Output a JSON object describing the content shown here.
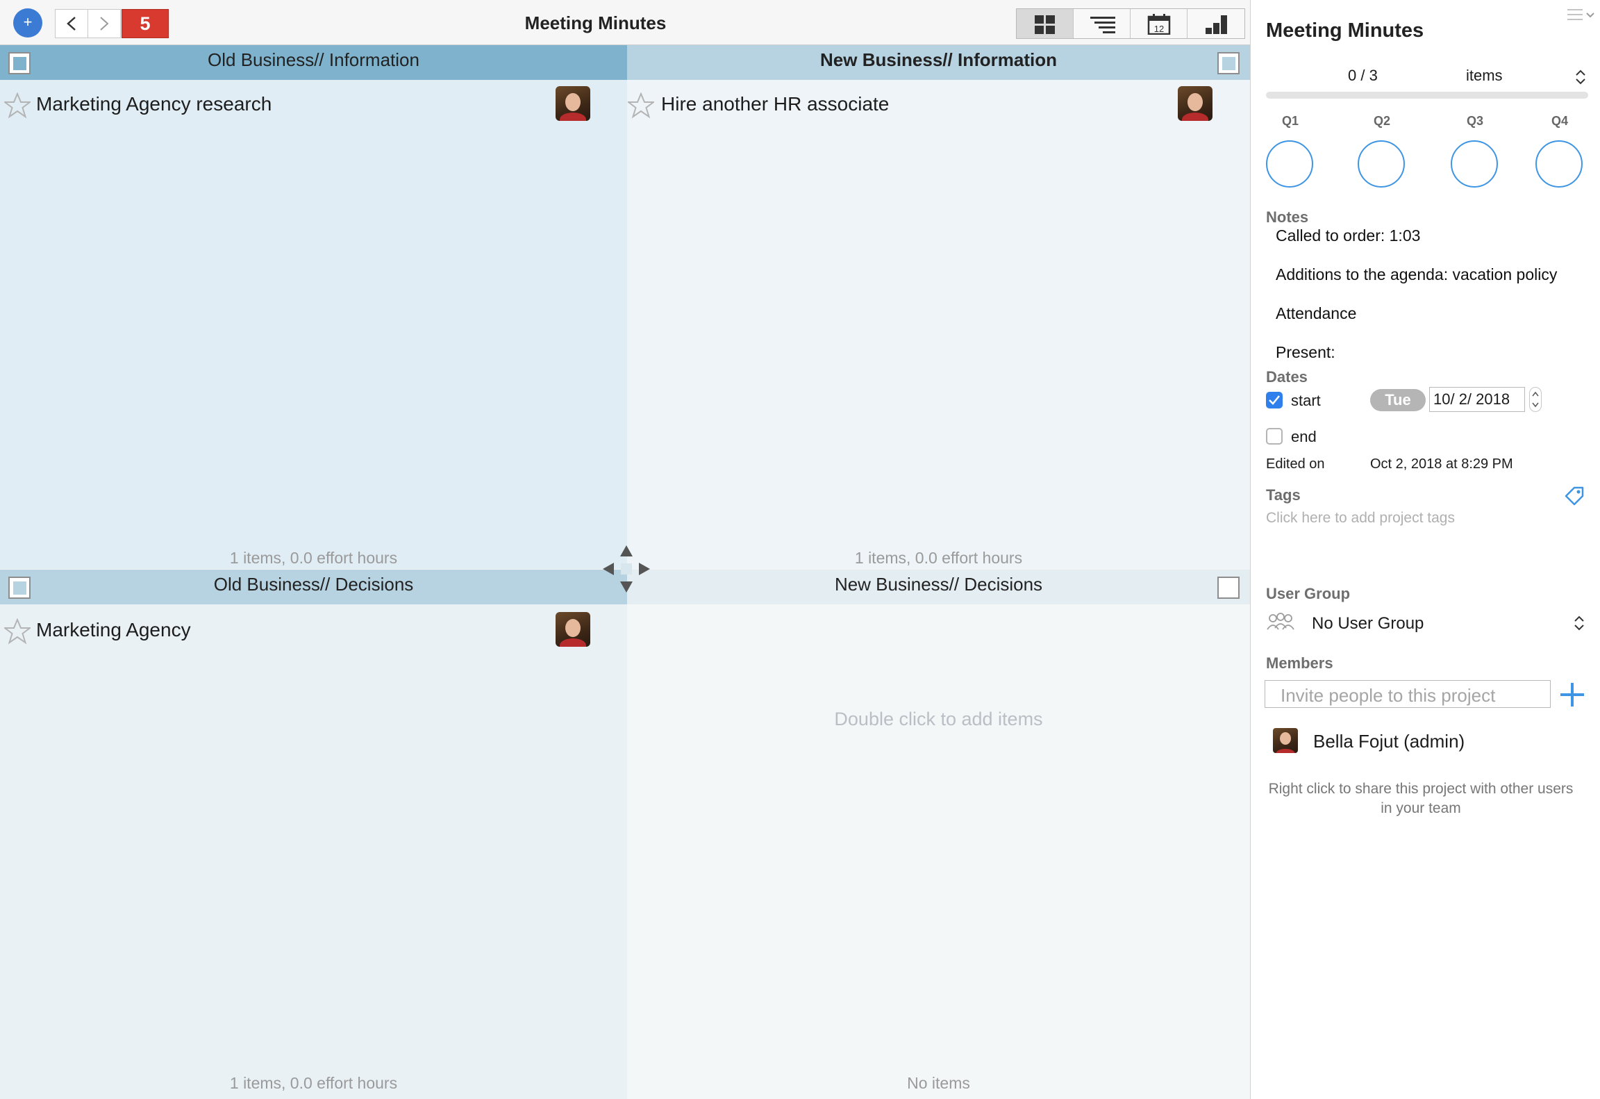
{
  "toolbar": {
    "add_label": "+",
    "count_badge": "5",
    "window_title": "Meeting Minutes",
    "views": [
      "matrix-view",
      "outline-view",
      "calendar-view",
      "chart-view"
    ],
    "calendar_day": "12"
  },
  "quadrants": {
    "q1": {
      "title": "Old Business// Information",
      "tasks": [
        {
          "label": "Marketing Agency research"
        }
      ],
      "footer": "1 items, 0.0 effort hours"
    },
    "q2": {
      "title": "New Business// Information",
      "tasks": [
        {
          "label": "Hire another HR associate"
        }
      ],
      "footer": "1 items, 0.0 effort hours"
    },
    "q3": {
      "title": "Old Business// Decisions",
      "tasks": [
        {
          "label": "Marketing Agency"
        }
      ],
      "footer": "1 items, 0.0 effort hours"
    },
    "q4": {
      "title": "New Business// Decisions",
      "empty_hint": "Double click to add items",
      "footer": "No items"
    }
  },
  "panel": {
    "title": "Meeting Minutes",
    "progress": {
      "text": "0 / 3",
      "unit": "items",
      "fraction": 0
    },
    "quarters": [
      "Q1",
      "Q2",
      "Q3",
      "Q4"
    ],
    "notes_label": "Notes",
    "notes": [
      "Called to order: 1:03",
      "Additions to the agenda: vacation policy",
      "Attendance",
      "Present:"
    ],
    "dates_label": "Dates",
    "start_label": "start",
    "start_checked": true,
    "start_day": "Tue",
    "start_date": "10/  2/ 2018",
    "end_label": "end",
    "end_checked": false,
    "edited_label": "Edited on",
    "edited_value": "Oct 2, 2018 at 8:29 PM",
    "tags_label": "Tags",
    "tags_placeholder": "Click here to add project tags",
    "user_group_label": "User Group",
    "user_group_value": "No User Group",
    "members_label": "Members",
    "invite_placeholder": "Invite people to this project",
    "members": [
      {
        "name": "Bella Fojut (admin)"
      }
    ],
    "share_hint": "Right click to share this project with other users in your team"
  },
  "colors": {
    "accent": "#3b7bd4",
    "badge_red": "#d83a30",
    "q1_header": "#7fb2cc",
    "q2_header": "#b7d2e0",
    "q1_body": "#e0edf4",
    "q4_body": "#f4f7f8"
  }
}
